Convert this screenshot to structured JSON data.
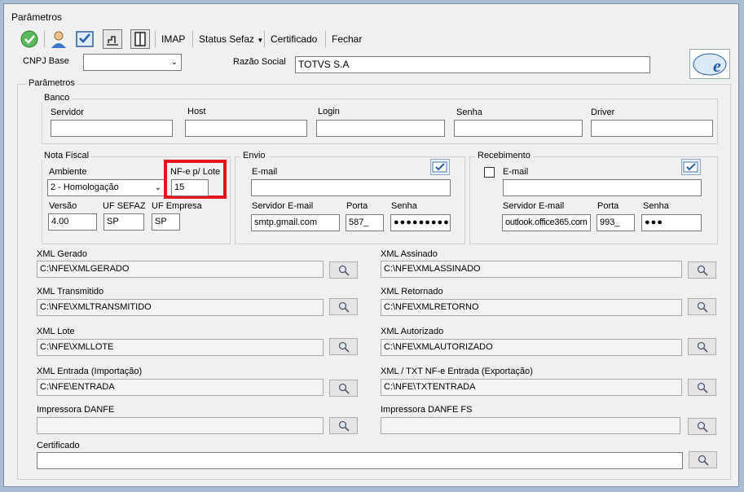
{
  "window_title": "Parâmetros",
  "toolbar": {
    "imap": "IMAP",
    "status_sefaz": "Status Sefaz",
    "certificado": "Certificado",
    "fechar": "Fechar"
  },
  "header": {
    "cnpj_label": "CNPJ Base",
    "cnpj_value": "",
    "razao_label": "Razão Social",
    "razao_value": "TOTVS  S.A"
  },
  "parametros_group": "Parâmetros",
  "banco": {
    "title": "Banco",
    "servidor_label": "Servidor",
    "servidor_value": "",
    "host_label": "Host",
    "host_value": "",
    "login_label": "Login",
    "login_value": "",
    "senha_label": "Senha",
    "senha_value": "",
    "driver_label": "Driver",
    "driver_value": ""
  },
  "nota_fiscal": {
    "title": "Nota Fiscal",
    "ambiente_label": "Ambiente",
    "ambiente_value": "2 - Homologação",
    "lote_label": "NF-e p/ Lote",
    "lote_value": "15",
    "versao_label": "Versão",
    "versao_value": "4.00",
    "uf_sefaz_label": "UF SEFAZ",
    "uf_sefaz_value": "SP",
    "uf_empresa_label": "UF Empresa",
    "uf_empresa_value": "SP"
  },
  "envio": {
    "title": "Envio",
    "email_label": "E-mail",
    "email_value": "",
    "servidor_label": "Servidor E-mail",
    "servidor_value": "smtp.gmail.com",
    "porta_label": "Porta",
    "porta_value": "587_",
    "senha_label": "Senha",
    "senha_value": "●●●●●●●●●"
  },
  "recebimento": {
    "title": "Recebimento",
    "email_label": "E-mail",
    "email_value": "",
    "servidor_label": "Servidor E-mail",
    "servidor_value": "outlook.office365.com",
    "porta_label": "Porta",
    "porta_value": "993_",
    "senha_label": "Senha",
    "senha_value": "●●●"
  },
  "paths": {
    "xml_gerado_label": "XML Gerado",
    "xml_gerado_value": "C:\\NFE\\XMLGERADO",
    "xml_assinado_label": "XML Assinado",
    "xml_assinado_value": "C:\\NFE\\XMLASSINADO",
    "xml_transmitido_label": "XML Transmitido",
    "xml_transmitido_value": "C:\\NFE\\XMLTRANSMITIDO",
    "xml_retornado_label": "XML Retornado",
    "xml_retornado_value": "C:\\NFE\\XMLRETORNO",
    "xml_lote_label": "XML Lote",
    "xml_lote_value": "C:\\NFE\\XMLLOTE",
    "xml_autorizado_label": "XML Autorizado",
    "xml_autorizado_value": "C:\\NFE\\XMLAUTORIZADO",
    "xml_entrada_label": "XML Entrada (Importação)",
    "xml_entrada_value": "C:\\NFE\\ENTRADA",
    "txt_entrada_label": "XML / TXT NF-e Entrada (Exportação)",
    "txt_entrada_value": "C:\\NFE\\TXTENTRADA",
    "impressora_danfe_label": "Impressora DANFE",
    "impressora_danfe_value": "",
    "impressora_danfe_fs_label": "Impressora DANFE FS",
    "impressora_danfe_fs_value": "",
    "certificado_label": "Certificado",
    "certificado_value": ""
  },
  "colors": {
    "highlight": "#e8141c",
    "background": "#f0f0f0",
    "frame": "#a9bdd6"
  }
}
